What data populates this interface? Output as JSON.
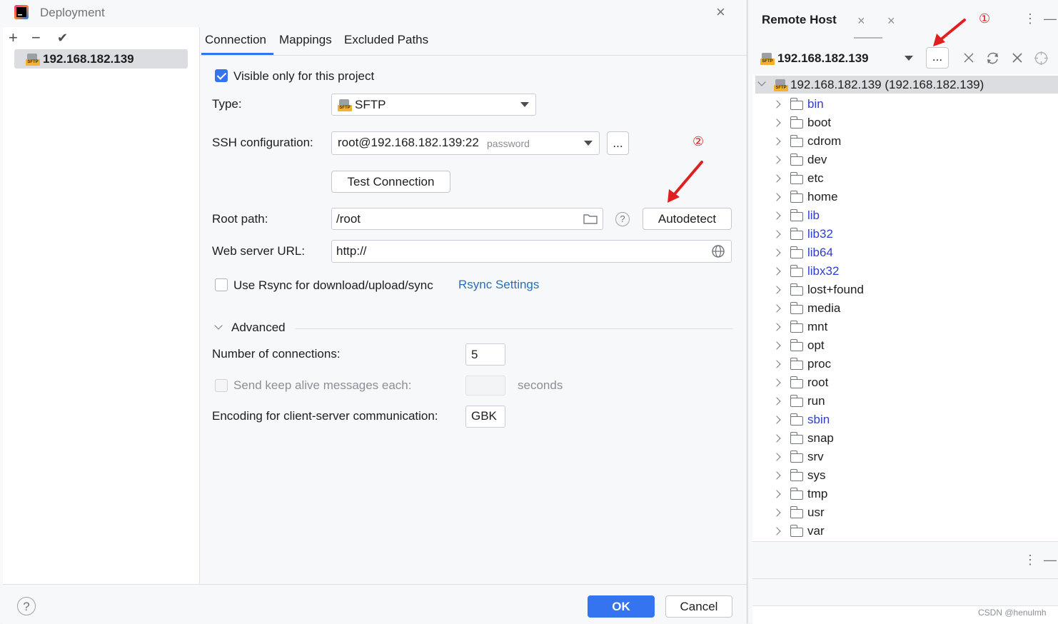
{
  "dialog": {
    "title": "Deployment",
    "close_glyph": "×",
    "toolbar": {
      "add": "+",
      "remove": "−",
      "apply": "✔"
    },
    "servers": [
      {
        "label": "192.168.182.139",
        "icon": "sftp-icon"
      }
    ],
    "tabs": [
      "Connection",
      "Mappings",
      "Excluded Paths"
    ],
    "active_tab": "Connection",
    "connection": {
      "visible_only_label": "Visible only for this project",
      "visible_only_checked": true,
      "type_label": "Type:",
      "type_value": "SFTP",
      "ssh_label": "SSH configuration:",
      "ssh_value": "root@192.168.182.139:22",
      "ssh_hint": "password",
      "ssh_more": "...",
      "test_connection": "Test Connection",
      "root_path_label": "Root path:",
      "root_path_value": "/root",
      "help_glyph": "?",
      "autodetect": "Autodetect",
      "web_url_label": "Web server URL:",
      "web_url_value": "http://",
      "rsync_label": "Use Rsync for download/upload/sync",
      "rsync_checked": false,
      "rsync_settings": "Rsync Settings",
      "advanced_label": "Advanced",
      "connections_label": "Number of connections:",
      "connections_value": "5",
      "keepalive_label": "Send keep alive messages each:",
      "keepalive_value": "",
      "keepalive_unit": "seconds",
      "encoding_label": "Encoding for client-server communication:",
      "encoding_value": "GBK"
    },
    "footer": {
      "help": "?",
      "ok": "OK",
      "cancel": "Cancel"
    }
  },
  "annotations": {
    "marker1": "①",
    "marker2": "②",
    "color": "#e02020"
  },
  "remote_host": {
    "title": "Remote Host",
    "host": "192.168.182.139",
    "more": "...",
    "root_label": "192.168.182.139 (192.168.182.139)",
    "folders": [
      {
        "name": "bin",
        "link": true
      },
      {
        "name": "boot",
        "link": false
      },
      {
        "name": "cdrom",
        "link": false
      },
      {
        "name": "dev",
        "link": false
      },
      {
        "name": "etc",
        "link": false
      },
      {
        "name": "home",
        "link": false
      },
      {
        "name": "lib",
        "link": true
      },
      {
        "name": "lib32",
        "link": true
      },
      {
        "name": "lib64",
        "link": true
      },
      {
        "name": "libx32",
        "link": true
      },
      {
        "name": "lost+found",
        "link": false
      },
      {
        "name": "media",
        "link": false
      },
      {
        "name": "mnt",
        "link": false
      },
      {
        "name": "opt",
        "link": false
      },
      {
        "name": "proc",
        "link": false
      },
      {
        "name": "root",
        "link": false
      },
      {
        "name": "run",
        "link": false
      },
      {
        "name": "sbin",
        "link": true
      },
      {
        "name": "snap",
        "link": false
      },
      {
        "name": "srv",
        "link": false
      },
      {
        "name": "sys",
        "link": false
      },
      {
        "name": "tmp",
        "link": false
      },
      {
        "name": "usr",
        "link": false
      },
      {
        "name": "var",
        "link": false
      }
    ]
  },
  "watermark": "CSDN @henulmh",
  "colors": {
    "accent": "#3574f0",
    "link": "#2f3ec8",
    "rsync_link": "#2a6ebb"
  }
}
